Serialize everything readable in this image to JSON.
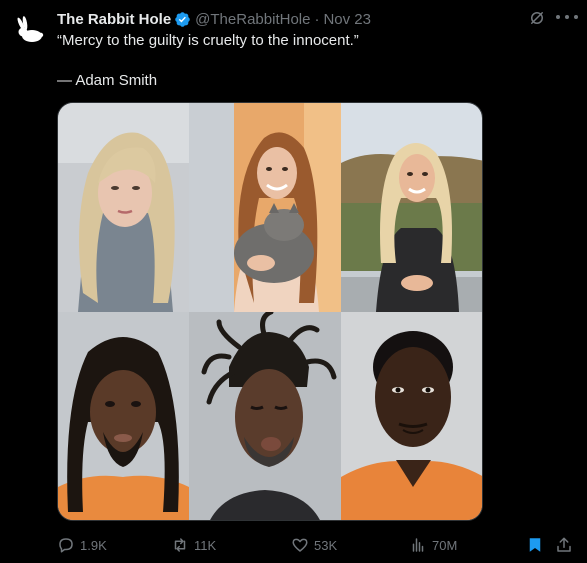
{
  "author": {
    "display_name": "The Rabbit Hole",
    "handle": "@TheRabbitHole",
    "separator": "·",
    "date": "Nov 23",
    "verified_color": "#1d9bf0",
    "avatar_icon": "rabbit-icon"
  },
  "tweet": {
    "line1": "“Mercy to the guilty is cruelty to the innocent.”",
    "line2": "— Adam Smith"
  },
  "media": {
    "layout": "2x3 photo collage",
    "photos": [
      {
        "id": "top-left",
        "desc": "blonde woman selfie"
      },
      {
        "id": "top-center",
        "desc": "woman holding gray cat"
      },
      {
        "id": "top-right",
        "desc": "blonde woman on balcony"
      },
      {
        "id": "bottom-left",
        "desc": "man with dreadlocks mugshot"
      },
      {
        "id": "bottom-center",
        "desc": "man with twisted locks mugshot"
      },
      {
        "id": "bottom-right",
        "desc": "man in orange jumpsuit mugshot"
      }
    ]
  },
  "actions": {
    "replies": "1.9K",
    "reposts": "11K",
    "likes": "53K",
    "views": "70M",
    "bookmark_color": "#1d9bf0"
  },
  "icons": {
    "grok": "grok-icon",
    "more": "more-icon",
    "reply": "reply-icon",
    "repost": "repost-icon",
    "like": "heart-icon",
    "views": "views-icon",
    "bookmark": "bookmark-icon",
    "share": "share-icon"
  }
}
